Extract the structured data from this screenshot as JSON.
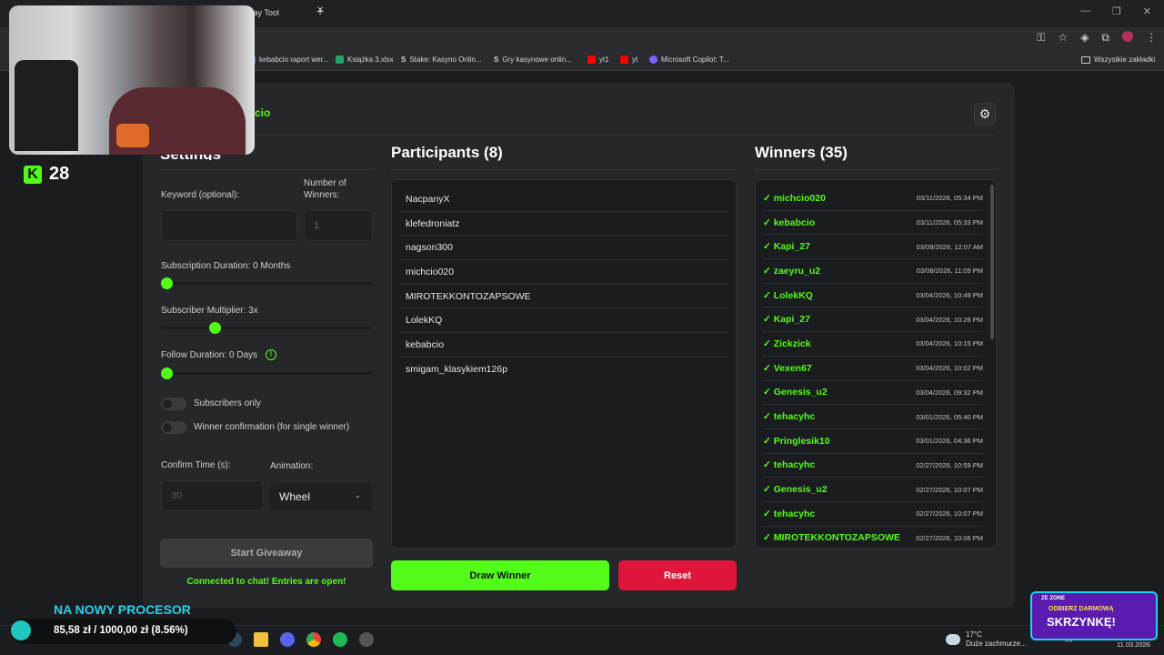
{
  "browser": {
    "tab_title": "eaway Tool",
    "bookmarks": [
      {
        "label": "kebabcio raport wer...",
        "icon": "doc-icon",
        "color": "#4a6fdc"
      },
      {
        "label": "Książka 3.xlsx",
        "icon": "excel-icon",
        "color": "#21a366"
      },
      {
        "label": "Stake: Kasyno Onlin...",
        "icon": "stake-icon",
        "color": "#dddddd"
      },
      {
        "label": "Gry kasynowe onlin...",
        "icon": "stake-icon",
        "color": "#dddddd"
      },
      {
        "label": "yt1",
        "icon": "youtube-icon",
        "color": "#ff0000"
      },
      {
        "label": "yt",
        "icon": "youtube-icon",
        "color": "#ff0000"
      },
      {
        "label": "Microsoft Copilot: T...",
        "icon": "copilot-icon",
        "color": "#7b61ff"
      }
    ],
    "bookmarks_all": "Wszystkie zakładki"
  },
  "app": {
    "brand": "abcio",
    "accent": "#53fc18",
    "danger": "#e0153c"
  },
  "overlay": {
    "kick_count": "28"
  },
  "settings": {
    "title": "Settings",
    "keyword_label": "Keyword (optional):",
    "winners_label": "Number of Winners:",
    "winners_value": "1",
    "sub_duration_label": "Subscription Duration: 0 Months",
    "sub_duration_level": 0,
    "sub_multiplier_label": "Subscriber Multiplier: 3x",
    "sub_multiplier_level": 0.24,
    "follow_label": "Follow Duration: 0  Days",
    "follow_level": 0,
    "subs_only_label": "Subscribers only",
    "winner_confirm_label": "Winner confirmation (for single winner)",
    "confirm_time_label": "Confirm Time (s):",
    "confirm_time_placeholder": "30",
    "animation_label": "Animation:",
    "animation_value": "Wheel",
    "start_button": "Start Giveaway",
    "status": "Connected to chat! Entries are open!"
  },
  "participants": {
    "title": "Participants (8)",
    "items": [
      "NacpanyX",
      "klefedroniatz",
      "nagson300",
      "michcio020",
      "MIROTEKKONTOZAPSOWE",
      "LolekKQ",
      "kebabcio",
      "smigam_klasykiem126p"
    ],
    "draw_button": "Draw Winner",
    "reset_button": "Reset"
  },
  "winners": {
    "title": "Winners (35)",
    "items": [
      {
        "name": "✓ michcio020",
        "date": "03/11/2026, 05:34 PM"
      },
      {
        "name": "✓ kebabcio",
        "date": "03/11/2026, 05:33 PM"
      },
      {
        "name": "✓ Kapi_27",
        "date": "03/09/2026, 12:07 AM"
      },
      {
        "name": "✓ zaeyru_u2",
        "date": "03/08/2026, 11:09 PM"
      },
      {
        "name": "✓ LolekKQ",
        "date": "03/04/2026, 10:49 PM"
      },
      {
        "name": "✓ Kapi_27",
        "date": "03/04/2026, 10:26 PM"
      },
      {
        "name": "✓ Zickzick",
        "date": "03/04/2026, 10:15 PM"
      },
      {
        "name": "✓ Vexen67",
        "date": "03/04/2026, 10:02 PM"
      },
      {
        "name": "✓ Genesis_u2",
        "date": "03/04/2026, 09:32 PM"
      },
      {
        "name": "✓ tehacyhc",
        "date": "03/01/2026, 05:40 PM"
      },
      {
        "name": "✓ Pringlesik10",
        "date": "03/01/2026, 04:36 PM"
      },
      {
        "name": "✓ tehacyhc",
        "date": "02/27/2026, 10:59 PM"
      },
      {
        "name": "✓ Genesis_u2",
        "date": "02/27/2026, 10:07 PM"
      },
      {
        "name": "✓ tehacyhc",
        "date": "02/27/2026, 10:07 PM"
      },
      {
        "name": "✓ MIROTEKKONTOZAPSOWE",
        "date": "02/27/2026, 10:06 PM"
      }
    ]
  },
  "promo": {
    "title": "NA NOWY PROCESOR",
    "progress_text": "85,58 zł / 1000,00 zł (8.56%)",
    "progress_fraction": 0.0856
  },
  "badge": {
    "line1": "ZE ZONE",
    "line2": "ODBIERZ DARMOWĄ",
    "line3": "SKRZYNKĘ!"
  },
  "taskbar": {
    "weather_temp": "17°C",
    "weather_desc": "Duże zachmurze...",
    "date": "11.03.2026"
  }
}
